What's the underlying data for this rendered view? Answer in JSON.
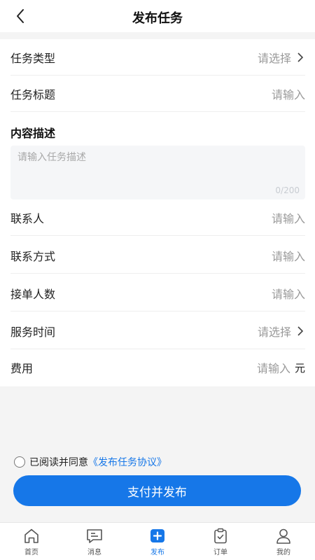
{
  "header": {
    "title": "发布任务"
  },
  "form": {
    "task_type": {
      "label": "任务类型",
      "value": "请选择"
    },
    "task_title": {
      "label": "任务标题",
      "value": "请输入"
    },
    "description": {
      "label": "内容描述",
      "placeholder": "请输入任务描述",
      "counter": "0/200"
    },
    "contact_person": {
      "label": "联系人",
      "value": "请输入"
    },
    "contact_method": {
      "label": "联系方式",
      "value": "请输入"
    },
    "taker_count": {
      "label": "接单人数",
      "value": "请输入"
    },
    "service_time": {
      "label": "服务时间",
      "value": "请选择"
    },
    "fee": {
      "label": "费用",
      "value": "请输入",
      "unit": "元"
    }
  },
  "agreement": {
    "prefix": "已阅读并同意",
    "link": "《发布任务协议》"
  },
  "submit": {
    "label": "支付并发布"
  },
  "tabs": [
    {
      "label": "首页",
      "icon": "home-icon"
    },
    {
      "label": "消息",
      "icon": "message-icon"
    },
    {
      "label": "发布",
      "icon": "publish-icon"
    },
    {
      "label": "订单",
      "icon": "order-icon"
    },
    {
      "label": "我的",
      "icon": "profile-icon"
    }
  ],
  "colors": {
    "accent": "#1677e8",
    "text": "#222222",
    "placeholder": "#9a9a9a",
    "background": "#f4f4f4"
  }
}
